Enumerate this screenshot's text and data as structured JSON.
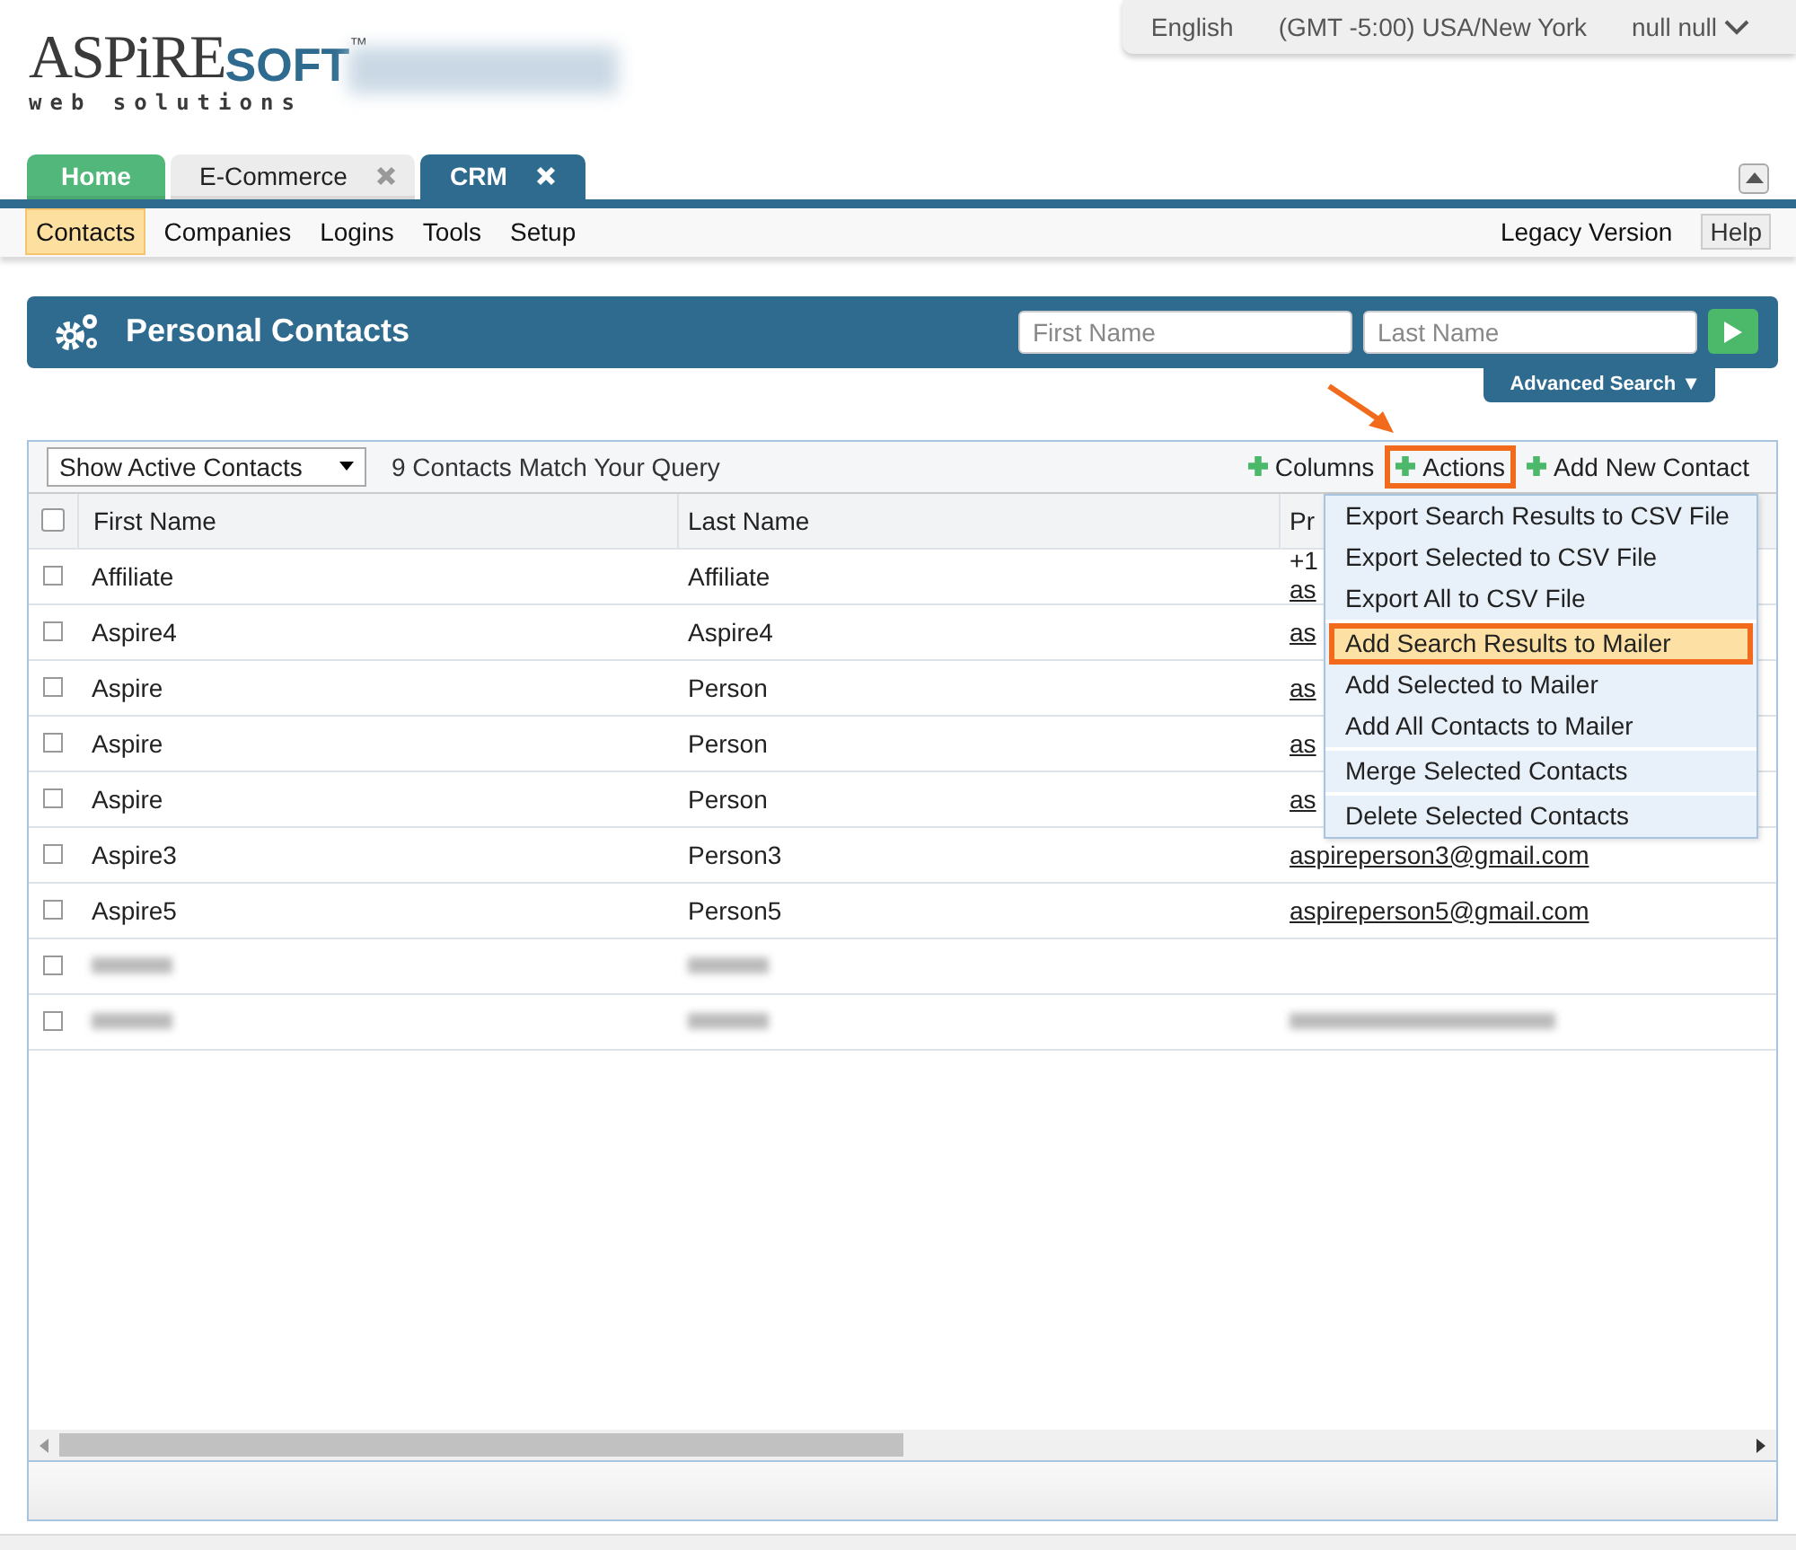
{
  "logo": {
    "name_left": "ASPiRE",
    "name_right": "SOFT",
    "mark": "™",
    "tagline": "web solutions"
  },
  "top_bar": {
    "language": "English",
    "timezone": "(GMT -5:00) USA/New York",
    "user": "null null"
  },
  "tabs": [
    {
      "label": "Home",
      "selected": false,
      "closable": false,
      "color": "#52b77a"
    },
    {
      "label": "E-Commerce",
      "selected": false,
      "closable": true,
      "color": "#ececec"
    },
    {
      "label": "CRM",
      "selected": true,
      "closable": true,
      "color": "#2e6b8f"
    }
  ],
  "nav": {
    "items": [
      {
        "label": "Contacts",
        "selected": true
      },
      {
        "label": "Companies",
        "selected": false
      },
      {
        "label": "Logins",
        "selected": false
      },
      {
        "label": "Tools",
        "selected": false
      },
      {
        "label": "Setup",
        "selected": false
      }
    ],
    "legacy": "Legacy Version",
    "help": "Help"
  },
  "header": {
    "title": "Personal Contacts",
    "first_name": {
      "placeholder": "First Name"
    },
    "last_name": {
      "placeholder": "Last Name"
    },
    "advanced_search": "Advanced Search ▼"
  },
  "grid": {
    "filter": "Show Active Contacts",
    "count": "9 Contacts Match Your Query",
    "tools": [
      {
        "label": "Columns",
        "highlighted": false
      },
      {
        "label": "Actions",
        "highlighted": true
      },
      {
        "label": "Add New Contact",
        "highlighted": false
      }
    ],
    "select_all_checked": false,
    "columns": [
      "First Name",
      "Last Name",
      "Pr"
    ],
    "rows": [
      {
        "first": "Affiliate",
        "last": "Affiliate",
        "column_3": [
          "+1",
          "as"
        ],
        "redacted": false,
        "checked": false
      },
      {
        "first": "Aspire4",
        "last": "Aspire4",
        "column_3": [
          "as"
        ],
        "redacted": false,
        "checked": false
      },
      {
        "first": "Aspire",
        "last": "Person",
        "column_3": [
          "as"
        ],
        "redacted": false,
        "checked": false
      },
      {
        "first": "Aspire",
        "last": "Person",
        "column_3": [
          "as"
        ],
        "redacted": false,
        "checked": false
      },
      {
        "first": "Aspire",
        "last": "Person",
        "column_3": [
          "as"
        ],
        "redacted": false,
        "checked": false
      },
      {
        "first": "Aspire3",
        "last": "Person3",
        "column_3": [
          "aspireperson3@gmail.com"
        ],
        "redacted": false,
        "checked": false
      },
      {
        "first": "Aspire5",
        "last": "Person5",
        "column_3": [
          "aspireperson5@gmail.com"
        ],
        "redacted": false,
        "checked": false
      },
      {
        "redacted": true,
        "checked": false
      },
      {
        "redacted": true,
        "checked": false
      }
    ],
    "actions_menu": [
      [
        {
          "label": "Export Search Results to CSV File",
          "selected": false
        },
        {
          "label": "Export Selected to CSV File",
          "selected": false
        },
        {
          "label": "Export All to CSV File",
          "selected": false
        }
      ],
      [
        {
          "label": "Add Search Results to Mailer",
          "selected": true
        },
        {
          "label": "Add Selected to Mailer",
          "selected": false
        },
        {
          "label": "Add All Contacts to Mailer",
          "selected": false
        }
      ],
      [
        {
          "label": "Merge Selected Contacts",
          "selected": false
        }
      ],
      [
        {
          "label": "Delete Selected Contacts",
          "selected": false
        }
      ]
    ]
  }
}
